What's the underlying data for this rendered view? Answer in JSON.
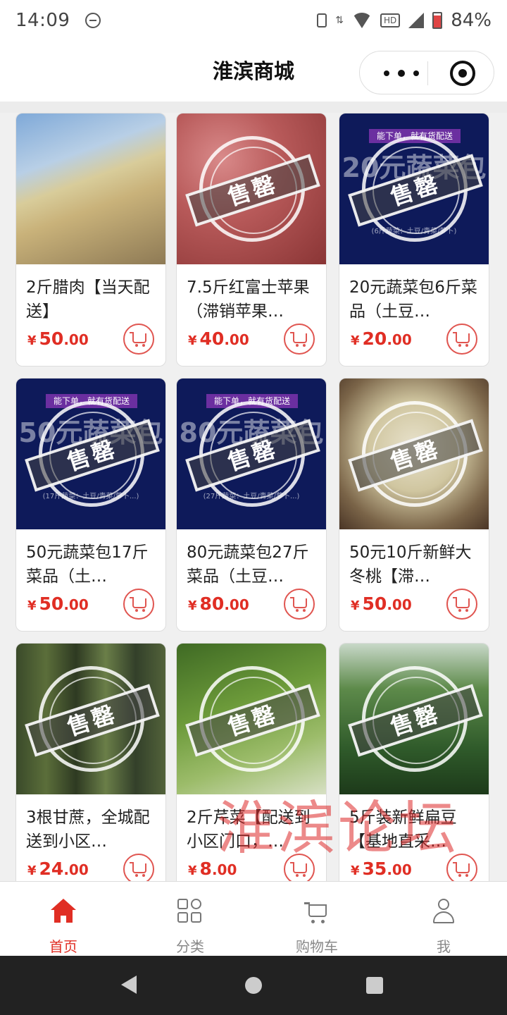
{
  "status_bar": {
    "time": "14:09",
    "battery": "84%",
    "network": "HD"
  },
  "header": {
    "title": "淮滨商城",
    "more_icon": "more-dots-icon",
    "close_icon": "target-close-icon"
  },
  "products": [
    {
      "name": "2斤腊肉【当天配送】",
      "price_symbol": "¥",
      "price_int": "50",
      "price_dec": ".00",
      "thumb": "bacon",
      "sold_out_label": ""
    },
    {
      "name": "7.5斤红富士苹果（滞销苹果…",
      "price_symbol": "¥",
      "price_int": "40",
      "price_dec": ".00",
      "thumb": "apple",
      "sold_out_label": "售罄"
    },
    {
      "name": "20元蔬菜包6斤菜品（土豆…",
      "price_symbol": "¥",
      "price_int": "20",
      "price_dec": ".00",
      "thumb": "navy",
      "sold_out_label": "售罄",
      "banner": "能下单，就有货配送",
      "big_text": "20元蔬菜包",
      "small_text": "(6斤蔬菜：土豆/青菜/萝卜)"
    },
    {
      "name": "50元蔬菜包17斤菜品（土…",
      "price_symbol": "¥",
      "price_int": "50",
      "price_dec": ".00",
      "thumb": "navy",
      "sold_out_label": "售罄",
      "banner": "能下单，就有货配送",
      "big_text": "50元蔬菜包",
      "small_text": "(17斤蔬菜：土豆/青菜/萝卜...)"
    },
    {
      "name": "80元蔬菜包27斤菜品（土豆…",
      "price_symbol": "¥",
      "price_int": "80",
      "price_dec": ".00",
      "thumb": "navy",
      "sold_out_label": "售罄",
      "banner": "能下单，就有货配送",
      "big_text": "80元蔬菜包",
      "small_text": "(27斤蔬菜：土豆/青菜/萝卜...)"
    },
    {
      "name": "50元10斤新鲜大冬桃【滞…",
      "price_symbol": "¥",
      "price_int": "50",
      "price_dec": ".00",
      "thumb": "peach",
      "sold_out_label": "售罄"
    },
    {
      "name": "3根甘蔗，全城配送到小区…",
      "price_symbol": "¥",
      "price_int": "24",
      "price_dec": ".00",
      "thumb": "cane",
      "sold_out_label": "售罄"
    },
    {
      "name": "2斤芹菜【配送到小区门口，…",
      "price_symbol": "¥",
      "price_int": "8",
      "price_dec": ".00",
      "thumb": "celery",
      "sold_out_label": "售罄"
    },
    {
      "name": "5斤装新鲜扁豆【基地直采…",
      "price_symbol": "¥",
      "price_int": "35",
      "price_dec": ".00",
      "thumb": "bean",
      "sold_out_label": "售罄"
    }
  ],
  "watermark": "淮滨论坛",
  "tab_bar": [
    {
      "label": "首页",
      "icon": "home-icon",
      "active": true
    },
    {
      "label": "分类",
      "icon": "category-icon",
      "active": false
    },
    {
      "label": "购物车",
      "icon": "cart-icon",
      "active": false
    },
    {
      "label": "我",
      "icon": "user-icon",
      "active": false
    }
  ],
  "colors": {
    "accent": "#e02e24",
    "navy_thumb": "#0e1a5a",
    "banner": "#6b2fa0"
  }
}
